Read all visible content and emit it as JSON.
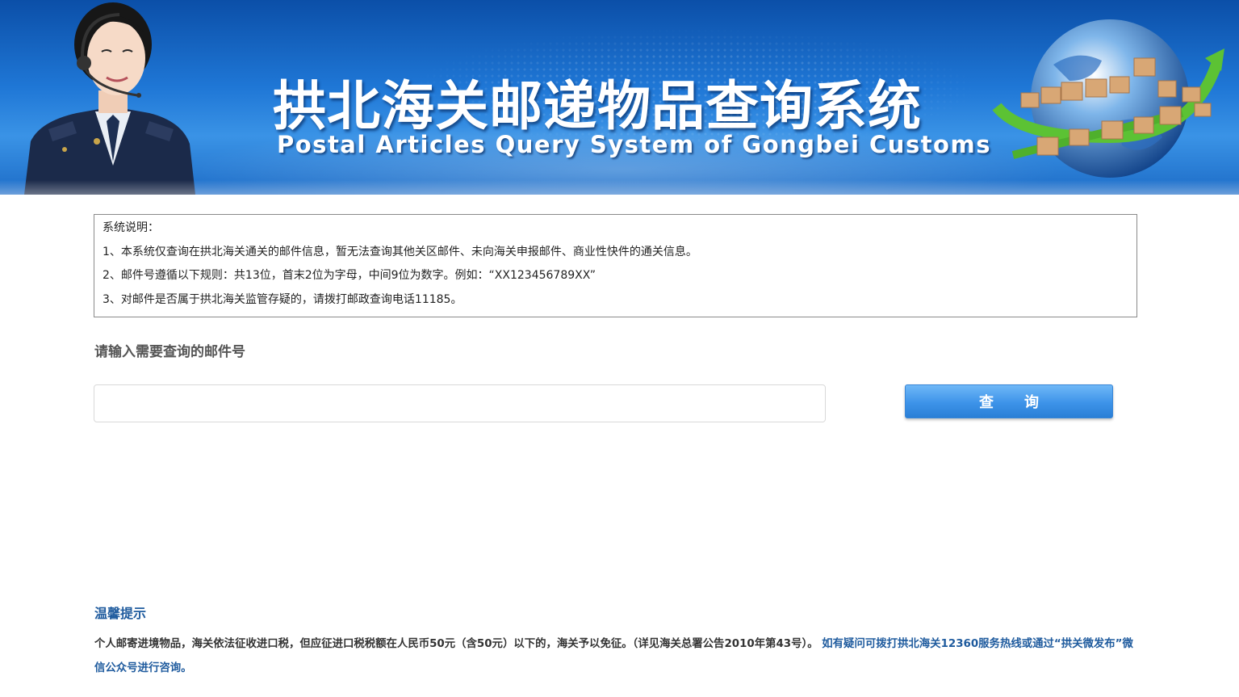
{
  "banner": {
    "title_cn": "拱北海关邮递物品查询系统",
    "title_en": "Postal Articles Query System of Gongbei Customs"
  },
  "notice": {
    "heading": "系统说明：",
    "items": [
      "1、本系统仅查询在拱北海关通关的邮件信息，暂无法查询其他关区邮件、未向海关申报邮件、商业性快件的通关信息。",
      "2、邮件号遵循以下规则：共13位，首末2位为字母，中间9位为数字。例如：“XX123456789XX”",
      "3、对邮件是否属于拱北海关监管存疑的，请拨打邮政查询电话11185。"
    ]
  },
  "query": {
    "label": "请输入需要查询的邮件号",
    "input_value": "",
    "input_placeholder": "",
    "button_char_1": "查",
    "button_char_2": "询"
  },
  "tips": {
    "title": "温馨提示",
    "text": "个人邮寄进境物品，海关依法征收进口税，但应征进口税税额在人民币50元（含50元）以下的，海关予以免征。（详见海关总署公告2010年第43号）。",
    "highlight": "如有疑问可拨打拱北海关12360服务热线或通过“拱关微发布”微信公众号进行咨询。"
  },
  "colors": {
    "banner_blue": "#1f77d6",
    "tips_blue": "#1f5b9e",
    "button_blue": "#3d93e9"
  }
}
